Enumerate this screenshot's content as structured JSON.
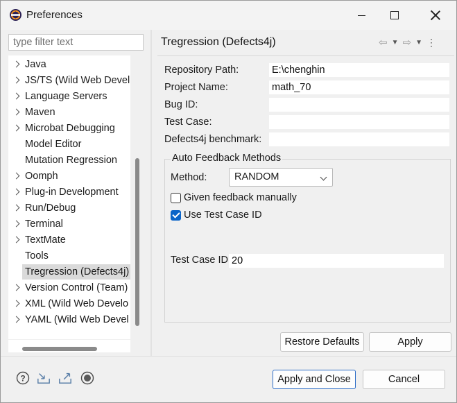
{
  "window": {
    "title": "Preferences",
    "icon": "eclipse-icon"
  },
  "filter": {
    "placeholder": "type filter text",
    "value": ""
  },
  "tree": {
    "items": [
      {
        "label": "Java",
        "expandable": true
      },
      {
        "label": "JS/TS (Wild Web Devel",
        "expandable": true
      },
      {
        "label": "Language Servers",
        "expandable": true
      },
      {
        "label": "Maven",
        "expandable": true
      },
      {
        "label": "Microbat Debugging",
        "expandable": true
      },
      {
        "label": "Model Editor",
        "expandable": false
      },
      {
        "label": "Mutation Regression",
        "expandable": false
      },
      {
        "label": "Oomph",
        "expandable": true
      },
      {
        "label": "Plug-in Development",
        "expandable": true
      },
      {
        "label": "Run/Debug",
        "expandable": true
      },
      {
        "label": "Terminal",
        "expandable": true
      },
      {
        "label": "TextMate",
        "expandable": true
      },
      {
        "label": "Tools",
        "expandable": false
      },
      {
        "label": "Tregression (Defects4j)",
        "expandable": false,
        "selected": true
      },
      {
        "label": "Version Control (Team)",
        "expandable": true
      },
      {
        "label": "XML (Wild Web Develo",
        "expandable": true
      },
      {
        "label": "YAML (Wild Web Devel",
        "expandable": true
      }
    ]
  },
  "page": {
    "title": "Tregression (Defects4j)",
    "nav_icons": [
      "back-arrow-icon",
      "chevron-down-icon",
      "forward-arrow-icon",
      "chevron-down-icon",
      "view-menu-icon"
    ]
  },
  "form": {
    "repository_path": {
      "label": "Repository Path:",
      "value": "E:\\chenghin"
    },
    "project_name": {
      "label": "Project Name:",
      "value": "math_70"
    },
    "bug_id": {
      "label": "Bug ID:",
      "value": ""
    },
    "test_case": {
      "label": "Test Case:",
      "value": ""
    },
    "defects4j_benchmark": {
      "label": "Defects4j benchmark:",
      "value": ""
    }
  },
  "feedback": {
    "group_label": "Auto Feedback Methods",
    "method_label": "Method:",
    "method_value": "RANDOM",
    "given_feedback_label": "Given feedback manually",
    "given_feedback_checked": false,
    "use_test_case_label": "Use Test Case ID",
    "use_test_case_checked": true,
    "test_case_id_label": "Test Case ID",
    "test_case_id_value": "20"
  },
  "buttons": {
    "restore_defaults": "Restore Defaults",
    "apply": "Apply",
    "apply_and_close": "Apply and Close",
    "cancel": "Cancel"
  },
  "bottom_icons": [
    "help-icon",
    "import-icon",
    "export-icon",
    "record-icon"
  ],
  "colors": {
    "accent": "#0a64c8",
    "selection": "#dadada"
  }
}
